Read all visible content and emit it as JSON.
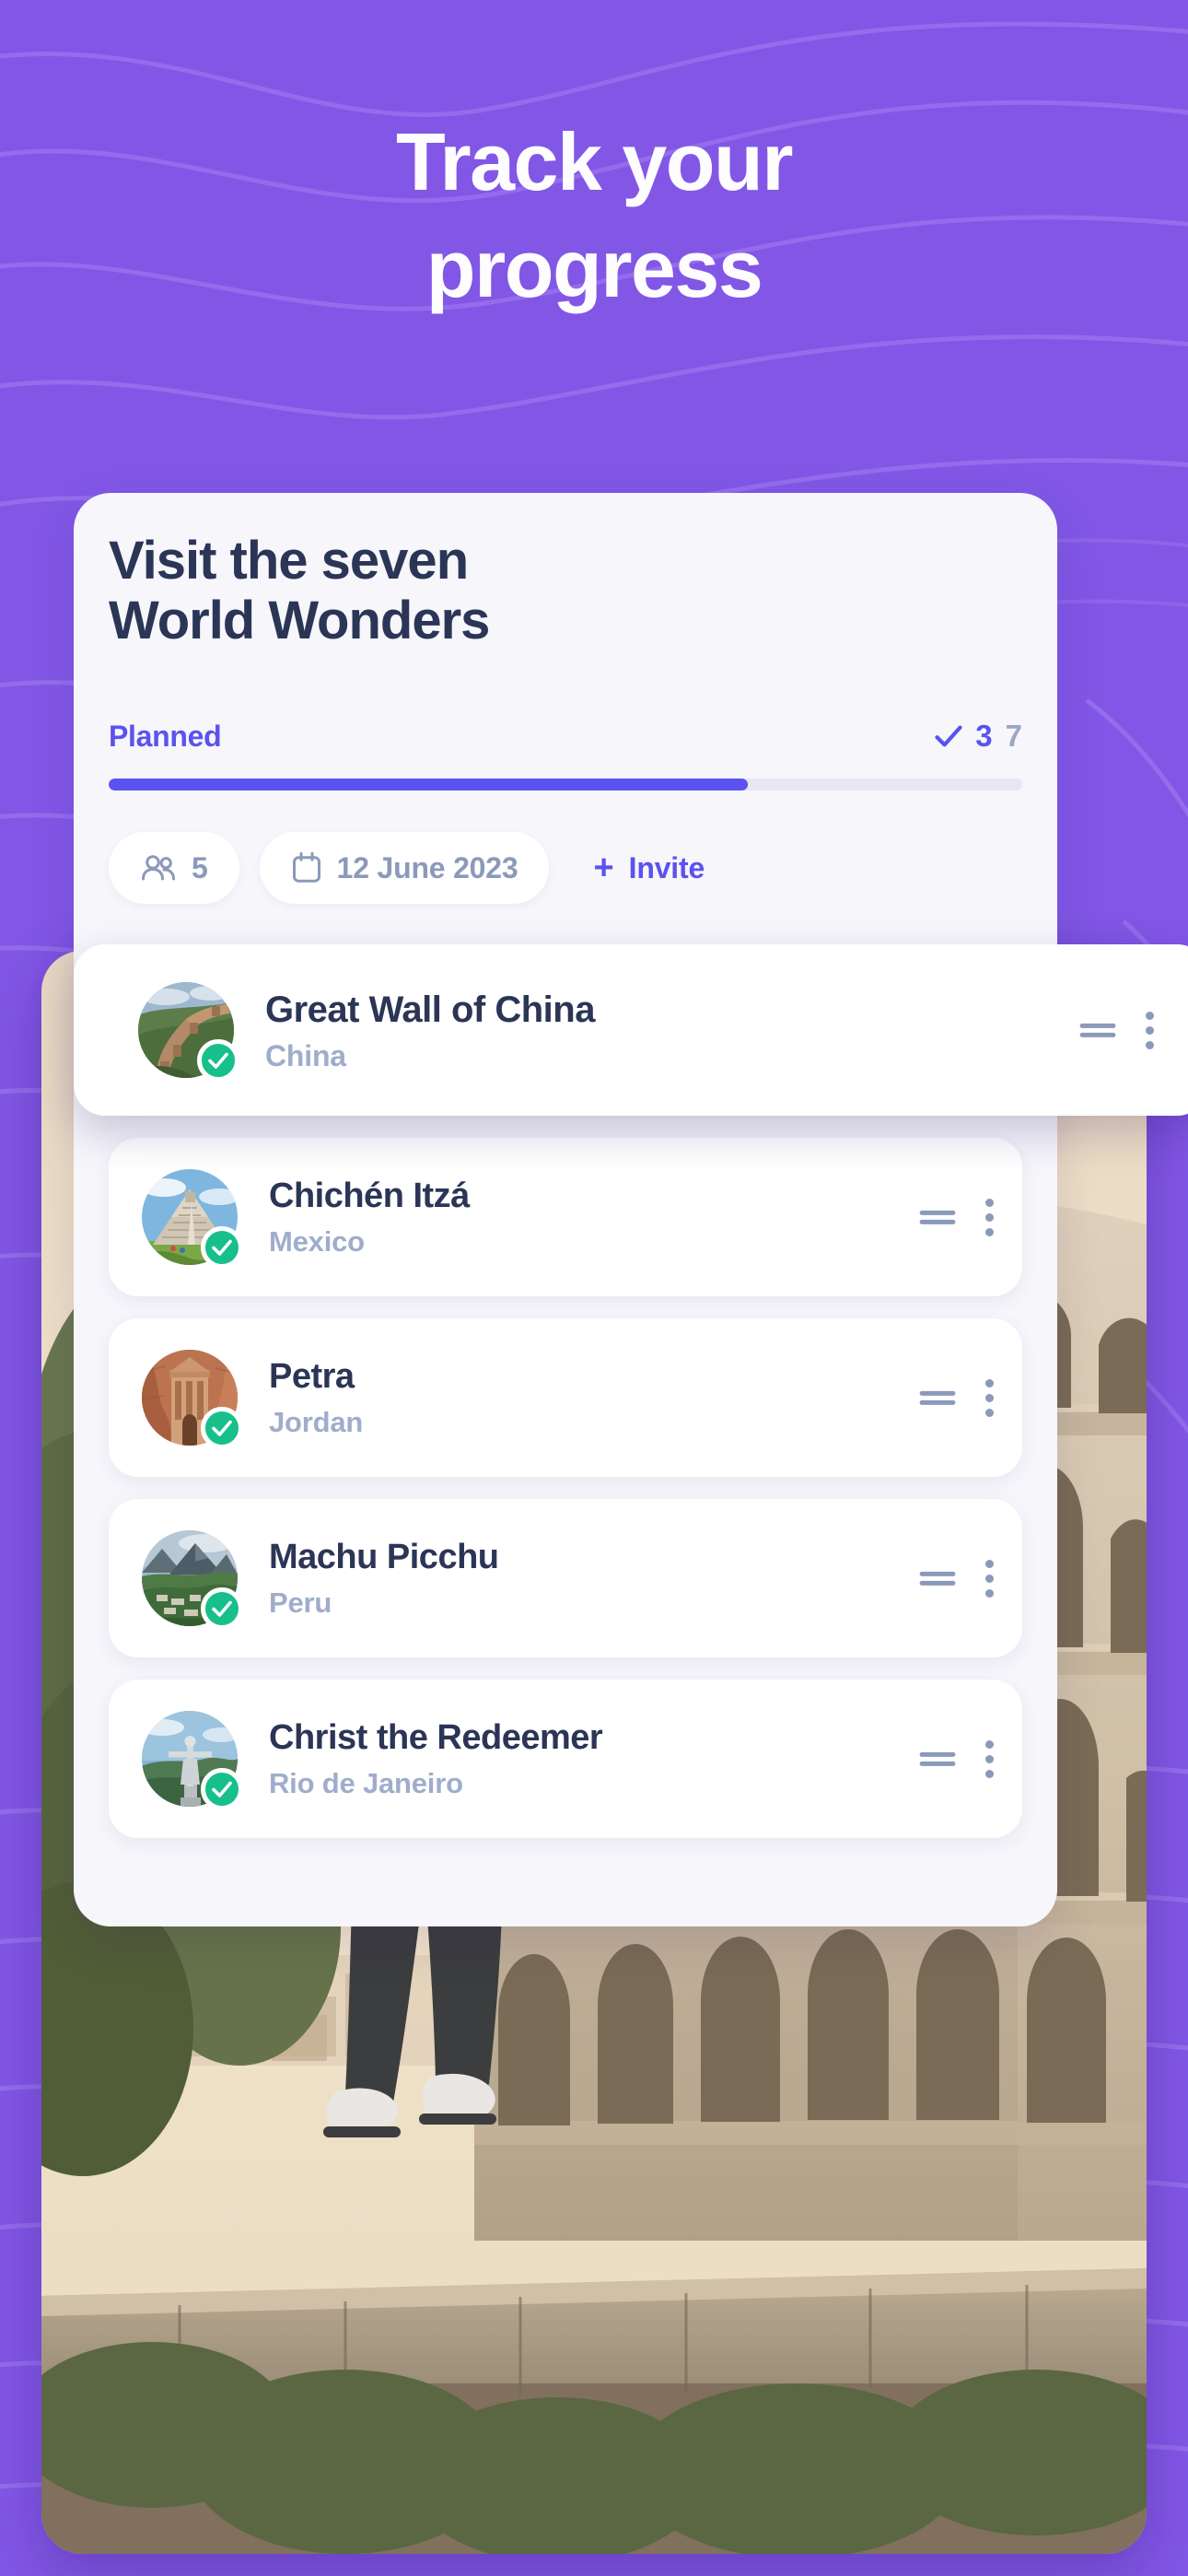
{
  "theme": {
    "background": "#8257e6",
    "card_bg": "#f6f6fb",
    "accent": "#5b52ef",
    "title_color": "#2b3556",
    "muted_color": "#8b99ba",
    "success": "#17c08a"
  },
  "hero": {
    "line1": "Track your",
    "line2": "progress"
  },
  "card": {
    "title": "Visit the seven World Wonders",
    "title_line1": "Visit the seven",
    "title_line2": "World Wonders",
    "progress": {
      "label": "Planned",
      "completed": "3",
      "total": "7",
      "percent": 70,
      "check_icon": "check-icon"
    },
    "pills": [
      {
        "icon": "people-icon",
        "label": "5",
        "name": "members-pill"
      },
      {
        "icon": "calendar-icon",
        "label": "12 June 2023",
        "name": "date-pill"
      },
      {
        "icon": "plus-icon",
        "label": "Invite",
        "name": "invite-pill"
      }
    ]
  },
  "wonders": [
    {
      "title": "Great Wall of China",
      "location": "China",
      "checked": true,
      "floating": true,
      "drag_icon": "drag-handle-icon",
      "menu_icon": "kebab-menu-icon"
    },
    {
      "title": "Chichén Itzá",
      "location": "Mexico",
      "checked": true,
      "floating": false,
      "drag_icon": "drag-handle-icon",
      "menu_icon": "kebab-menu-icon"
    },
    {
      "title": "Petra",
      "location": "Jordan",
      "checked": true,
      "floating": false,
      "drag_icon": "drag-handle-icon",
      "menu_icon": "kebab-menu-icon"
    },
    {
      "title": "Machu Picchu",
      "location": "Peru",
      "checked": true,
      "floating": false,
      "drag_icon": "drag-handle-icon",
      "menu_icon": "kebab-menu-icon"
    },
    {
      "title": "Christ the Redeemer",
      "location": "Rio de Janeiro",
      "checked": true,
      "floating": false,
      "drag_icon": "drag-handle-icon",
      "menu_icon": "kebab-menu-icon"
    }
  ],
  "photo": {
    "name": "colosseum-photo",
    "alt": "Person walking on a wall in front of the Colosseum"
  }
}
